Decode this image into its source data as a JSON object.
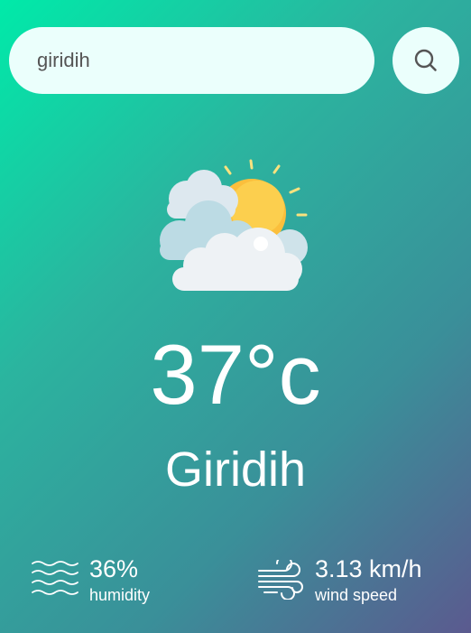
{
  "search": {
    "value": "giridih",
    "icon": "search-icon"
  },
  "weather": {
    "icon": "partly-cloudy-icon",
    "temperature": "37°c",
    "city": "Giridih"
  },
  "humidity": {
    "icon": "humidity-waves-icon",
    "value": "36%",
    "label": "humidity"
  },
  "wind": {
    "icon": "wind-icon",
    "value": "3.13 km/h",
    "label": "wind speed"
  },
  "colors": {
    "gradient_start": "#00eaa9",
    "gradient_end": "#5b5a8f",
    "input_background": "#ebfffc",
    "sun": "#fbbf3c"
  }
}
